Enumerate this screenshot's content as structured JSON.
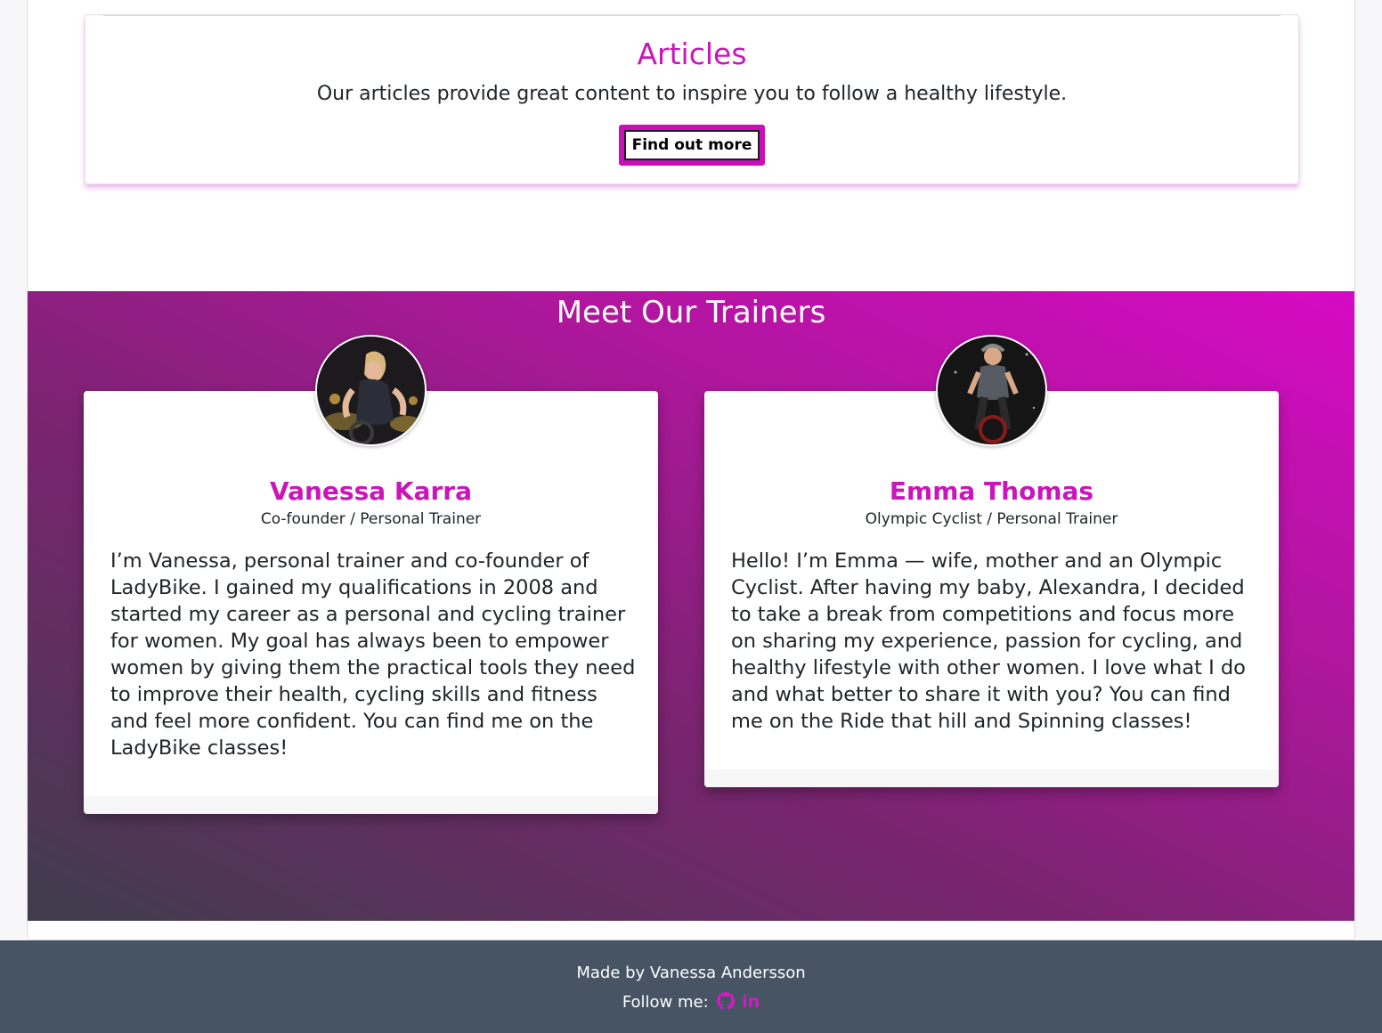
{
  "articles": {
    "title": "Articles",
    "description": "Our articles provide great content to inspire you to follow a healthy lifestyle.",
    "button_label": "Find out more"
  },
  "trainers": {
    "heading": "Meet Our Trainers",
    "items": [
      {
        "name": "Vanessa Karra",
        "role": "Co-founder / Personal Trainer",
        "bio": "I’m Vanessa, personal trainer and co-founder of LadyBike. I gained my qualifications in 2008 and started my career as a personal and cycling trainer for women. My goal has always been to empower women by giving them the practical tools they need to improve their health, cycling skills and fitness and feel more confident. You can find me on the LadyBike classes!"
      },
      {
        "name": "Emma Thomas",
        "role": "Olympic Cyclist / Personal Trainer",
        "bio": "Hello! I’m Emma — wife, mother and an Olympic Cyclist. After having my baby, Alexandra, I decided to take a break from competitions and focus more on sharing my experience, passion for cycling, and healthy lifestyle with other women. I love what I do and what better to share it with you? You can find me on the Ride that hill and Spinning classes!"
      }
    ]
  },
  "footer": {
    "made_by": "Made by Vanessa Andersson",
    "follow_label": "Follow me:",
    "linkedin_text": "in",
    "icons": [
      "github-icon",
      "linkedin-icon"
    ]
  },
  "colors": {
    "accent": "#c916b9",
    "footer_bg": "#465464"
  }
}
